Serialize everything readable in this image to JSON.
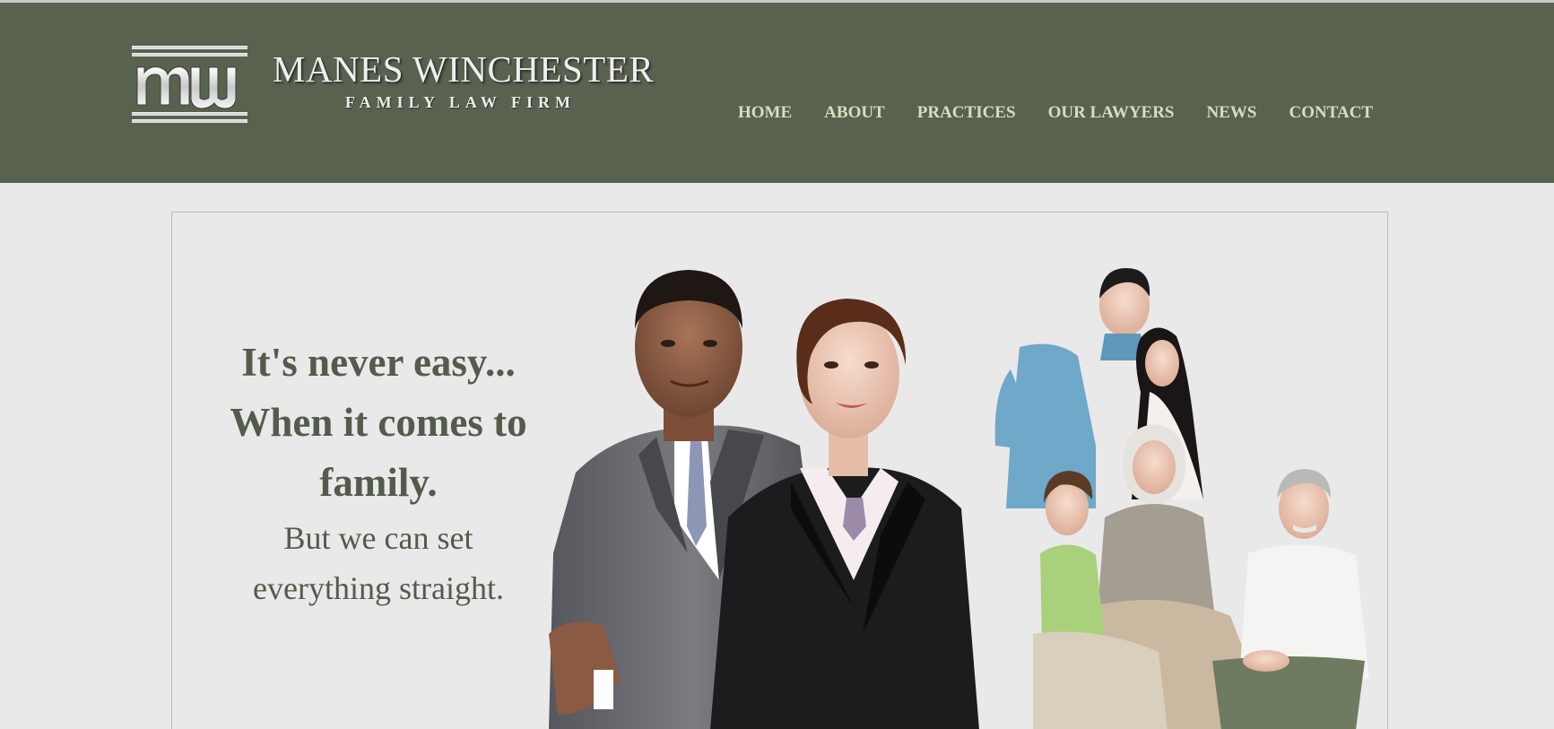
{
  "brand": {
    "monogram": "MW",
    "name": "MANES WINCHESTER",
    "tagline": "FAMILY LAW FIRM"
  },
  "nav": {
    "items": [
      {
        "label": "HOME"
      },
      {
        "label": "ABOUT"
      },
      {
        "label": "PRACTICES"
      },
      {
        "label": "OUR LAWYERS"
      },
      {
        "label": "NEWS"
      },
      {
        "label": "CONTACT"
      }
    ]
  },
  "hero": {
    "headline_line1": "It's never easy...",
    "headline_line2": "When it comes to",
    "headline_line3": "family.",
    "subline_line1": "But we can set",
    "subline_line2": "everything straight.",
    "image_icon": "people-photo-icon"
  },
  "colors": {
    "header_bg": "#59614f",
    "nav_text": "#d9ddc0",
    "page_bg": "#e9e9e9",
    "hero_text": "#545b4b"
  }
}
